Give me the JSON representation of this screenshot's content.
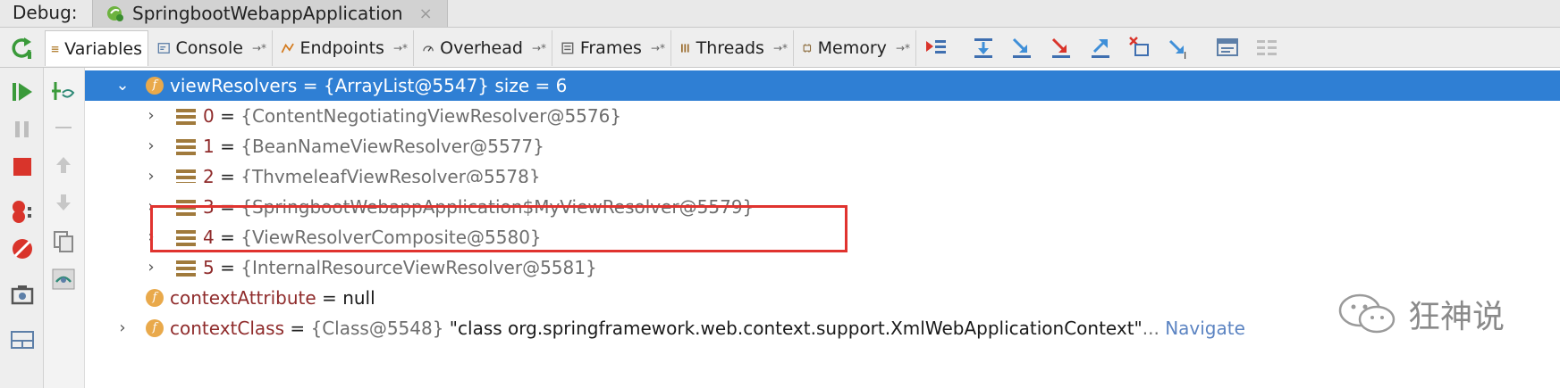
{
  "debug": {
    "label": "Debug:",
    "app_tab": "SpringbootWebappApplication",
    "close": "×"
  },
  "toolbar": {
    "tabs": [
      {
        "label": "Variables",
        "icon": "variables-icon"
      },
      {
        "label": "Console",
        "icon": "console-icon",
        "pin": "→*"
      },
      {
        "label": "Endpoints",
        "icon": "endpoints-icon",
        "pin": "→*"
      },
      {
        "label": "Overhead",
        "icon": "overhead-icon",
        "pin": "→*"
      },
      {
        "label": "Frames",
        "icon": "frames-icon",
        "pin": "→*"
      },
      {
        "label": "Threads",
        "icon": "threads-icon",
        "pin": "→*"
      },
      {
        "label": "Memory",
        "icon": "memory-icon",
        "pin": "→*"
      }
    ]
  },
  "tree": {
    "root": {
      "name": "viewResolvers",
      "eq": " = ",
      "value": "{ArrayList@5547}  size = 6"
    },
    "items": [
      {
        "index": "0",
        "eq": " = ",
        "value": "{ContentNegotiatingViewResolver@5576}"
      },
      {
        "index": "1",
        "eq": " = ",
        "value": "{BeanNameViewResolver@5577}"
      },
      {
        "index": "2",
        "eq": " = ",
        "value": "{ThymeleafViewResolver@5578}"
      },
      {
        "index": "3",
        "eq": " = ",
        "value": "{SpringbootWebappApplication$MyViewResolver@5579}"
      },
      {
        "index": "4",
        "eq": " = ",
        "value": "{ViewResolverComposite@5580}"
      },
      {
        "index": "5",
        "eq": " = ",
        "value": "{InternalResourceViewResolver@5581}"
      }
    ],
    "context_attribute": {
      "name": "contextAttribute",
      "eq": " = ",
      "value": "null"
    },
    "context_class": {
      "name": "contextClass",
      "eq": " = ",
      "value": "{Class@5548}",
      "string": " \"class org.springframework.web.context.support.XmlWebApplicationContext\"",
      "ellipsis": "...",
      "navigate": "Navigate"
    }
  },
  "watermark": {
    "text": "狂神说"
  },
  "colors": {
    "selection": "#2f7fd4",
    "highlight_box": "#e0332f",
    "field_name": "#8f2b2b"
  }
}
